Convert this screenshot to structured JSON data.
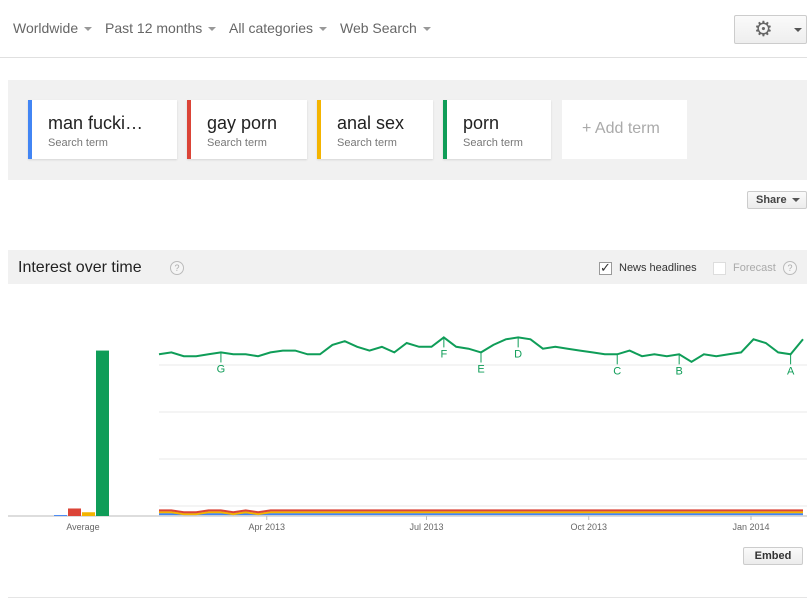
{
  "filters": {
    "region": "Worldwide",
    "time": "Past 12 months",
    "category": "All categories",
    "search_type": "Web Search"
  },
  "settings": {
    "icon": "gear-icon"
  },
  "terms": [
    {
      "name": "man fucki…",
      "sub": "Search term",
      "color": "#4285f4"
    },
    {
      "name": "gay porn",
      "sub": "Search term",
      "color": "#db4437"
    },
    {
      "name": "anal sex",
      "sub": "Search term",
      "color": "#f4b400"
    },
    {
      "name": "porn",
      "sub": "Search term",
      "color": "#0f9d58"
    }
  ],
  "add_term_label": "+ Add term",
  "share_label": "Share",
  "interest": {
    "title": "Interest over time",
    "help_icon": "?",
    "news_headlines_label": "News headlines",
    "news_headlines_checked": true,
    "forecast_label": "Forecast",
    "forecast_enabled": false
  },
  "embed_label": "Embed",
  "chart_data": {
    "type": "line",
    "ylim": [
      0,
      100
    ],
    "x_tick_labels": [
      "Apr 2013",
      "Jul 2013",
      "Oct 2013",
      "Jan 2014"
    ],
    "x_tick_weeks": [
      8.7,
      21.6,
      34.7,
      47.8
    ],
    "average_label": "Average",
    "averages": [
      {
        "name": "man fucki…",
        "value": 0.5,
        "color": "#4285f4"
      },
      {
        "name": "gay porn",
        "value": 4,
        "color": "#db4437"
      },
      {
        "name": "anal sex",
        "value": 2,
        "color": "#f4b400"
      },
      {
        "name": "porn",
        "value": 88,
        "color": "#0f9d58"
      }
    ],
    "series": [
      {
        "name": "porn",
        "color": "#0f9d58",
        "values": [
          86,
          87,
          85,
          85,
          86,
          87,
          86,
          86,
          85,
          87,
          88,
          88,
          86,
          86,
          91,
          93,
          90,
          88,
          90,
          87,
          92,
          90,
          90,
          95,
          90,
          89,
          87,
          91,
          94,
          95,
          94,
          89,
          90,
          89,
          88,
          87,
          86,
          86,
          88,
          85,
          86,
          85,
          86,
          82,
          86,
          85,
          86,
          87,
          94,
          92,
          87,
          86,
          94
        ]
      },
      {
        "name": "gay porn",
        "color": "#db4437",
        "values": [
          3,
          3,
          2,
          2,
          3,
          3,
          2,
          3,
          2,
          3,
          3,
          3,
          3,
          3,
          3,
          3,
          3,
          3,
          3,
          3,
          3,
          3,
          3,
          3,
          3,
          3,
          3,
          3,
          3,
          3,
          3,
          3,
          3,
          3,
          3,
          3,
          3,
          3,
          3,
          3,
          3,
          3,
          3,
          3,
          3,
          3,
          3,
          3,
          3,
          3,
          3,
          3,
          3
        ]
      },
      {
        "name": "anal sex",
        "color": "#f4b400",
        "values": [
          2,
          2,
          1,
          1,
          2,
          2,
          1,
          2,
          1,
          2,
          2,
          2,
          2,
          2,
          2,
          2,
          2,
          2,
          2,
          2,
          2,
          2,
          2,
          2,
          2,
          2,
          2,
          2,
          2,
          2,
          2,
          2,
          2,
          2,
          2,
          2,
          2,
          2,
          2,
          2,
          2,
          2,
          2,
          2,
          2,
          2,
          2,
          2,
          2,
          2,
          2,
          2,
          2
        ]
      },
      {
        "name": "man fucki…",
        "color": "#4285f4",
        "values": [
          1,
          1,
          1,
          1,
          1,
          1,
          1,
          1,
          1,
          1,
          1,
          1,
          1,
          1,
          1,
          1,
          1,
          1,
          1,
          1,
          1,
          1,
          1,
          1,
          1,
          1,
          1,
          1,
          1,
          1,
          1,
          1,
          1,
          1,
          1,
          1,
          1,
          1,
          1,
          1,
          1,
          1,
          1,
          1,
          1,
          1,
          1,
          1,
          1,
          1,
          1,
          1,
          1
        ]
      }
    ],
    "annotations": [
      {
        "label": "G",
        "week": 5
      },
      {
        "label": "F",
        "week": 23
      },
      {
        "label": "E",
        "week": 26
      },
      {
        "label": "D",
        "week": 29
      },
      {
        "label": "C",
        "week": 37
      },
      {
        "label": "B",
        "week": 42
      },
      {
        "label": "A",
        "week": 51
      }
    ]
  }
}
